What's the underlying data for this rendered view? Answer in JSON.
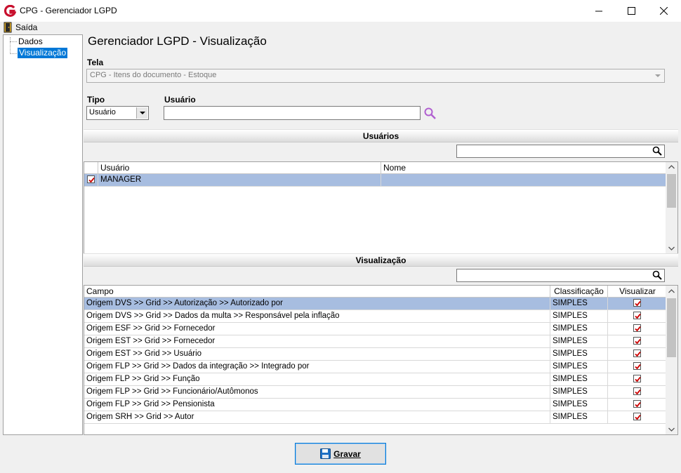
{
  "window": {
    "title": "CPG - Gerenciador LGPD",
    "minimize": "minimize",
    "maximize": "maximize",
    "close": "close"
  },
  "menu": {
    "exit_label": "Saída"
  },
  "tree": {
    "items": [
      {
        "label": "Dados"
      },
      {
        "label": "Visualização"
      }
    ]
  },
  "header": {
    "title": "Gerenciador LGPD - Visualização"
  },
  "form": {
    "tela_label": "Tela",
    "tela_value": "CPG - Itens do documento - Estoque",
    "tipo_label": "Tipo",
    "tipo_value": "Usuário",
    "usuario_label": "Usuário",
    "usuario_value": ""
  },
  "users_section": {
    "title": "Usuários",
    "search_value": "",
    "columns": [
      "Usuário",
      "Nome"
    ],
    "rows": [
      {
        "checked": true,
        "usuario": "MANAGER",
        "nome": ""
      }
    ]
  },
  "vis_section": {
    "title": "Visualização",
    "search_value": "",
    "columns": [
      "Campo",
      "Classificação",
      "Visualizar"
    ],
    "rows": [
      {
        "campo": "Origem DVS >> Grid >> Autorização >> Autorizado por",
        "classificacao": "SIMPLES",
        "visualizar": true
      },
      {
        "campo": "Origem DVS >> Grid >> Dados da multa >> Responsável pela inflação",
        "classificacao": "SIMPLES",
        "visualizar": true
      },
      {
        "campo": "Origem ESF >> Grid >> Fornecedor",
        "classificacao": "SIMPLES",
        "visualizar": true
      },
      {
        "campo": "Origem EST >> Grid >> Fornecedor",
        "classificacao": "SIMPLES",
        "visualizar": true
      },
      {
        "campo": "Origem EST >> Grid >> Usuário",
        "classificacao": "SIMPLES",
        "visualizar": true
      },
      {
        "campo": "Origem FLP >> Grid >> Dados da integração >> Integrado por",
        "classificacao": "SIMPLES",
        "visualizar": true
      },
      {
        "campo": "Origem FLP >> Grid >> Função",
        "classificacao": "SIMPLES",
        "visualizar": true
      },
      {
        "campo": "Origem FLP >> Grid >> Funcionário/Autômonos",
        "classificacao": "SIMPLES",
        "visualizar": true
      },
      {
        "campo": "Origem FLP >> Grid >> Pensionista",
        "classificacao": "SIMPLES",
        "visualizar": true
      },
      {
        "campo": "Origem SRH >> Grid >> Autor",
        "classificacao": "SIMPLES",
        "visualizar": true
      }
    ]
  },
  "footer": {
    "save_label": "Gravar"
  },
  "colors": {
    "accent": "#0078d7",
    "selection": "#a7bde0",
    "check": "#cc0000",
    "search_icon": "#b060d0"
  }
}
